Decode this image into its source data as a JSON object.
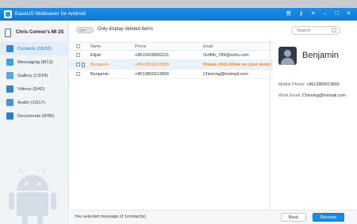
{
  "window": {
    "title": "EaseUS Mobisaver for Android",
    "accent": "#1a8ae5"
  },
  "titlebar_icons": [
    "cart-icon",
    "key-icon",
    "menu-icon",
    "minimize-icon",
    "maximize-icon",
    "close-icon"
  ],
  "device": {
    "name": "Chris Connor's MI 2S"
  },
  "sidebar": {
    "items": [
      {
        "label": "Contacts (18/32)",
        "icon": "contacts-icon",
        "color": "#3a86d0"
      },
      {
        "label": "Messaging (8/13)",
        "icon": "message-icon",
        "color": "#4a9ad8"
      },
      {
        "label": "Gallery (13/24)",
        "icon": "gallery-icon",
        "color": "#5ba7dd"
      },
      {
        "label": "Videos (9/42)",
        "icon": "video-icon",
        "color": "#3f7fc4"
      },
      {
        "label": "Audio (10/17)",
        "icon": "audio-icon",
        "color": "#4b90d2"
      },
      {
        "label": "Documents (8/95)",
        "icon": "document-icon",
        "color": "#2f7cc7"
      }
    ]
  },
  "toolbar": {
    "toggle_state": "OFF",
    "toggle_label": "Only display deleted items",
    "search_placeholder": "Search"
  },
  "table": {
    "headers": {
      "name": "Name",
      "phone": "Phone",
      "email": "Email"
    },
    "rows": [
      {
        "name": "Elijah",
        "phone": "+8615928695221",
        "email": "Griffith_789@sohu.com",
        "deleted": false
      },
      {
        "name": "Benjamin",
        "phone": "+8613800013800",
        "email": "Please click Allow on your device",
        "deleted": true
      },
      {
        "name": "Benjamin",
        "phone": "+8613800013800",
        "email": "Chinning@hotmail.com",
        "deleted": false
      }
    ]
  },
  "detail": {
    "name": "Benjamin",
    "phone_label": "Mobile Phone:",
    "phone": "+8613800013800",
    "email_label": "Work Email:",
    "email": "Chinning@hotmail.com"
  },
  "footer": {
    "status": "You selected message of 1contact(s)",
    "back_label": "Back",
    "recover_label": "Recover"
  }
}
